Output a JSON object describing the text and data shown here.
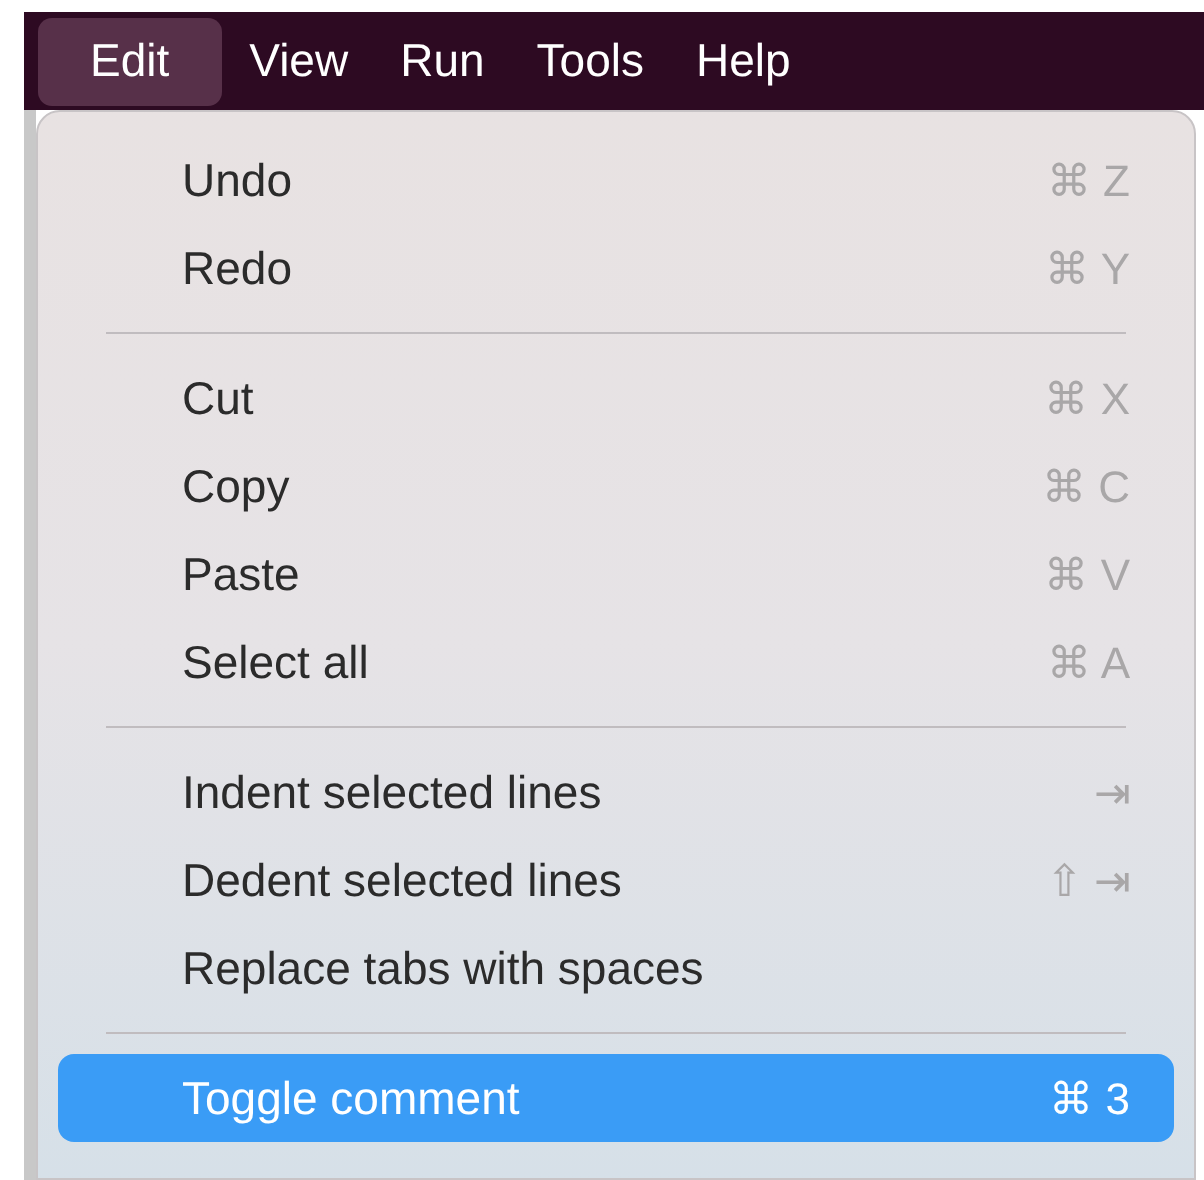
{
  "menubar": [
    {
      "label": "Edit",
      "selected": true
    },
    {
      "label": "View",
      "selected": false
    },
    {
      "label": "Run",
      "selected": false
    },
    {
      "label": "Tools",
      "selected": false
    },
    {
      "label": "Help",
      "selected": false
    }
  ],
  "menu": {
    "sections": [
      [
        {
          "label": "Undo",
          "shortcut": "⌘ Z",
          "selected": false
        },
        {
          "label": "Redo",
          "shortcut": "⌘ Y",
          "selected": false
        }
      ],
      [
        {
          "label": "Cut",
          "shortcut": "⌘ X",
          "selected": false
        },
        {
          "label": "Copy",
          "shortcut": "⌘ C",
          "selected": false
        },
        {
          "label": "Paste",
          "shortcut": "⌘ V",
          "selected": false
        },
        {
          "label": "Select all",
          "shortcut": "⌘ A",
          "selected": false
        }
      ],
      [
        {
          "label": "Indent selected lines",
          "shortcut": "⇥",
          "selected": false
        },
        {
          "label": "Dedent selected lines",
          "shortcut": "⇧ ⇥",
          "selected": false
        },
        {
          "label": "Replace tabs with spaces",
          "selected": false
        }
      ],
      [
        {
          "label": "Toggle comment",
          "shortcut": "⌘ 3",
          "selected": true
        }
      ]
    ]
  }
}
